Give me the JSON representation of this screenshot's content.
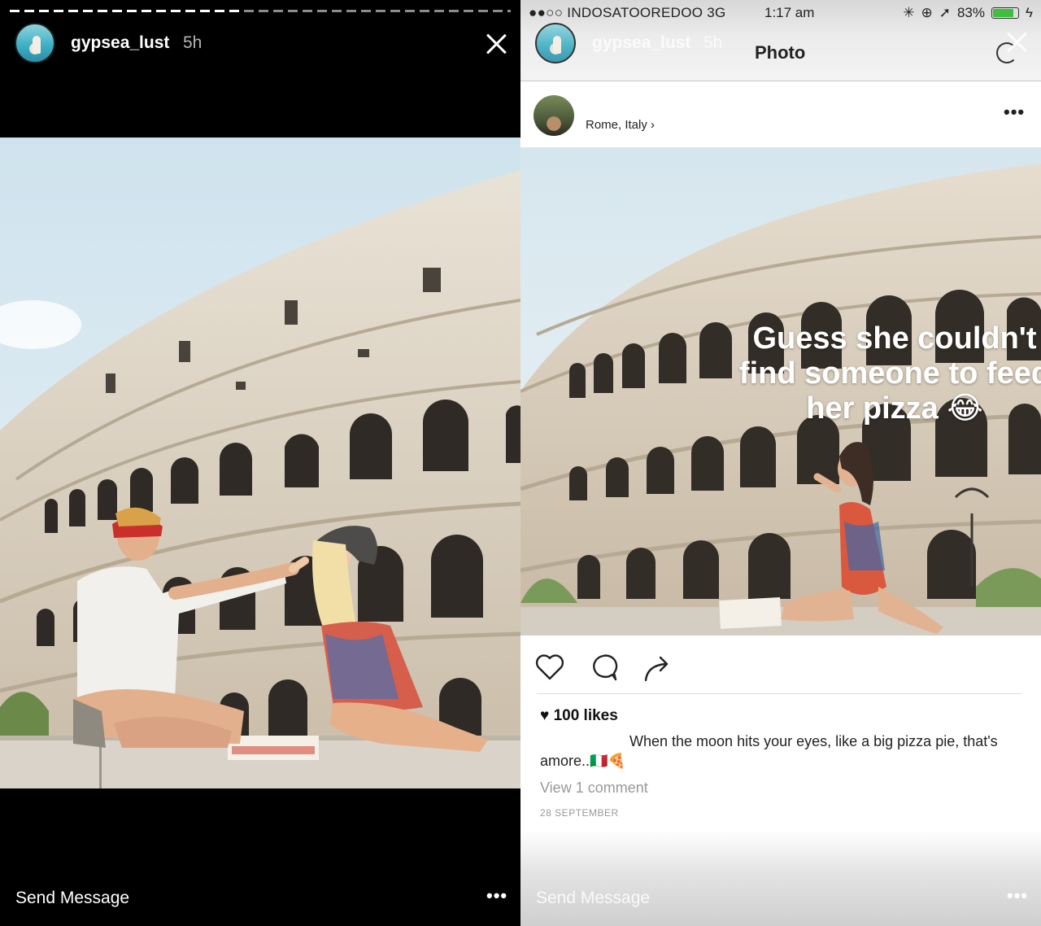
{
  "left_story": {
    "username": "gypsea_lust",
    "time_ago": "5h",
    "footer": {
      "send_message": "Send Message"
    }
  },
  "right_story": {
    "status_bar": {
      "carrier": "INDOSATOOREDOO 3G",
      "time": "1:17 am",
      "battery": "83%"
    },
    "username": "gypsea_lust",
    "time_ago": "5h",
    "nav_title": "Photo",
    "post": {
      "location": "Rome, Italy",
      "overlay_text": [
        "Guess she couldn't",
        "find someone to feed",
        "her pizza 😂"
      ],
      "likes": "100 likes",
      "caption": "When the moon hits your eyes, like a big pizza pie, that's amore..🇮🇹🍕",
      "view_comments": "View 1 comment",
      "date": "28 SEPTEMBER"
    },
    "footer": {
      "send_message": "Send Message"
    }
  },
  "colors": {
    "battery_green": "#3fbf3f",
    "header_gray": "#e8e8e8"
  }
}
